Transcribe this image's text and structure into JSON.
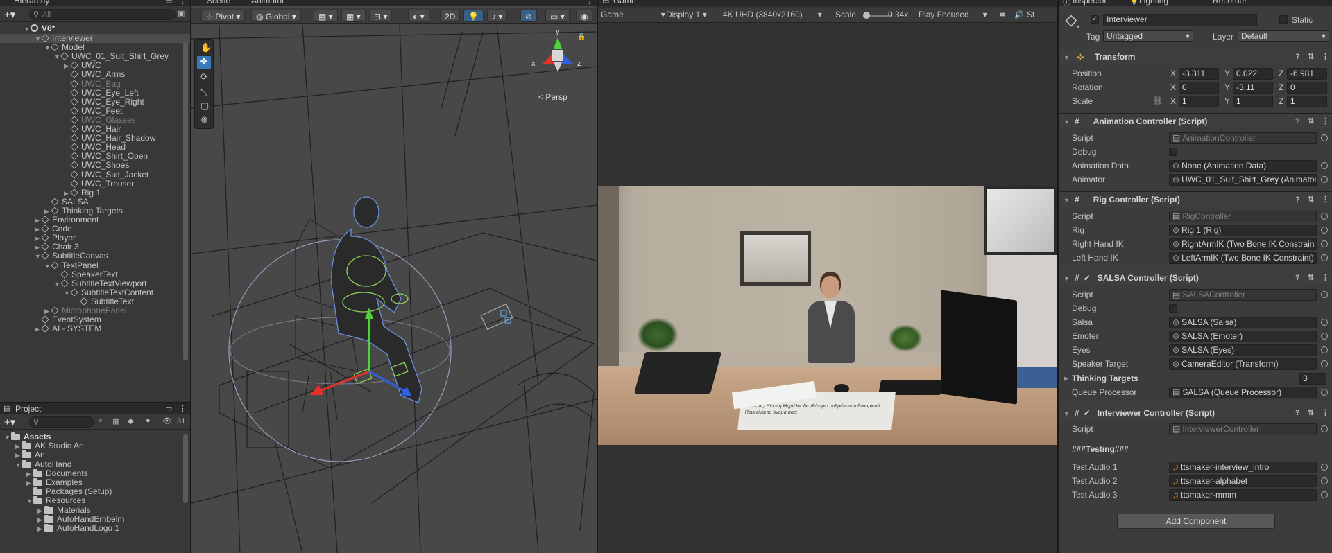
{
  "hierarchy": {
    "tab": "Hierarchy",
    "search_placeholder": "All",
    "scene": "V6*",
    "items": [
      {
        "label": "Interviewer",
        "depth": 1,
        "caret": "▼",
        "dim": false,
        "selected": true
      },
      {
        "label": "Model",
        "depth": 2,
        "caret": "▼",
        "dim": false
      },
      {
        "label": "UWC_01_Suit_Shirt_Grey",
        "depth": 3,
        "caret": "▼",
        "dim": false
      },
      {
        "label": "UWC",
        "depth": 4,
        "caret": "▶",
        "dim": false
      },
      {
        "label": "UWC_Arms",
        "depth": 4,
        "caret": "",
        "dim": false
      },
      {
        "label": "UWC_Bag",
        "depth": 4,
        "caret": "",
        "dim": true
      },
      {
        "label": "UWC_Eye_Left",
        "depth": 4,
        "caret": "",
        "dim": false
      },
      {
        "label": "UWC_Eye_Right",
        "depth": 4,
        "caret": "",
        "dim": false
      },
      {
        "label": "UWC_Feet",
        "depth": 4,
        "caret": "",
        "dim": false
      },
      {
        "label": "UWC_Glasses",
        "depth": 4,
        "caret": "",
        "dim": true
      },
      {
        "label": "UWC_Hair",
        "depth": 4,
        "caret": "",
        "dim": false
      },
      {
        "label": "UWC_Hair_Shadow",
        "depth": 4,
        "caret": "",
        "dim": false
      },
      {
        "label": "UWC_Head",
        "depth": 4,
        "caret": "",
        "dim": false
      },
      {
        "label": "UWC_Shirt_Open",
        "depth": 4,
        "caret": "",
        "dim": false
      },
      {
        "label": "UWC_Shoes",
        "depth": 4,
        "caret": "",
        "dim": false
      },
      {
        "label": "UWC_Suit_Jacket",
        "depth": 4,
        "caret": "",
        "dim": false
      },
      {
        "label": "UWC_Trouser",
        "depth": 4,
        "caret": "",
        "dim": false
      },
      {
        "label": "Rig 1",
        "depth": 4,
        "caret": "▶",
        "dim": false
      },
      {
        "label": "SALSA",
        "depth": 2,
        "caret": "",
        "dim": false
      },
      {
        "label": "Thinking Targets",
        "depth": 2,
        "caret": "▶",
        "dim": false
      },
      {
        "label": "Environment",
        "depth": 1,
        "caret": "▶",
        "dim": false
      },
      {
        "label": "Code",
        "depth": 1,
        "caret": "▶",
        "dim": false
      },
      {
        "label": "Player",
        "depth": 1,
        "caret": "▶",
        "dim": false
      },
      {
        "label": "Chair 3",
        "depth": 1,
        "caret": "▶",
        "dim": false
      },
      {
        "label": "SubtitleCanvas",
        "depth": 1,
        "caret": "▼",
        "dim": false
      },
      {
        "label": "TextPanel",
        "depth": 2,
        "caret": "▼",
        "dim": false
      },
      {
        "label": "SpeakerText",
        "depth": 3,
        "caret": "",
        "dim": false
      },
      {
        "label": "SubtitleTextViewport",
        "depth": 3,
        "caret": "▼",
        "dim": false
      },
      {
        "label": "SubtitleTextContent",
        "depth": 4,
        "caret": "▼",
        "dim": false
      },
      {
        "label": "SubtitleText",
        "depth": 5,
        "caret": "",
        "dim": false
      },
      {
        "label": "MicrophonePanel",
        "depth": 2,
        "caret": "▶",
        "dim": true
      },
      {
        "label": "EventSystem",
        "depth": 1,
        "caret": "",
        "dim": false
      },
      {
        "label": "AI - SYSTEM",
        "depth": 1,
        "caret": "▶",
        "dim": false
      }
    ]
  },
  "project": {
    "tab": "Project",
    "count": "31",
    "items": [
      {
        "label": "Assets",
        "depth": 0,
        "caret": "▼",
        "bold": true
      },
      {
        "label": "AK Studio Art",
        "depth": 1,
        "caret": "▶"
      },
      {
        "label": "Art",
        "depth": 1,
        "caret": "▶"
      },
      {
        "label": "AutoHand",
        "depth": 1,
        "caret": "▼"
      },
      {
        "label": "Documents",
        "depth": 2,
        "caret": "▶"
      },
      {
        "label": "Examples",
        "depth": 2,
        "caret": "▶"
      },
      {
        "label": "Packages (Setup)",
        "depth": 2,
        "caret": ""
      },
      {
        "label": "Resources",
        "depth": 2,
        "caret": "▼"
      },
      {
        "label": "Materials",
        "depth": 3,
        "caret": "▶"
      },
      {
        "label": "AutoHandEmbelm",
        "depth": 3,
        "caret": "▶"
      },
      {
        "label": "AutoHandLogo 1",
        "depth": 3,
        "caret": "▶"
      }
    ]
  },
  "scene": {
    "tabs": [
      "Scene",
      "Animator"
    ],
    "pivot": "Pivot",
    "global": "Global",
    "mode_2d": "2D",
    "persp": "< Persp",
    "gizmo_y": "y",
    "gizmo_x": "x",
    "gizmo_z": "z"
  },
  "game": {
    "tab": "Game",
    "view": "Game",
    "display": "Display 1",
    "resolution": "4K UHD (3840x2160)",
    "scale_label": "Scale",
    "scale_value": "0.34x",
    "play_mode": "Play Focused",
    "stats": "St",
    "note_title": "Μιχαέλα",
    "note_text": "Γεια σας! Είμαι η Μιχαέλα, διευθύντρια ανθρώπινου δυναμικού. Ποιο είναι το όνομά σας;"
  },
  "inspector": {
    "tabs": [
      "Inspector",
      "Lighting",
      "Recorder"
    ],
    "object_name": "Interviewer",
    "static_label": "Static",
    "tag_label": "Tag",
    "tag_value": "Untagged",
    "layer_label": "Layer",
    "layer_value": "Default",
    "transform": {
      "title": "Transform",
      "position_label": "Position",
      "rotation_label": "Rotation",
      "scale_label": "Scale",
      "position": [
        "-3.311",
        "0.022",
        "-6.981"
      ],
      "rotation": [
        "0",
        "-3.11",
        "0"
      ],
      "scale": [
        "1",
        "1",
        "1"
      ]
    },
    "animation_controller": {
      "title": "Animation Controller (Script)",
      "rows": [
        {
          "label": "Script",
          "value": "AnimationController",
          "dim": true
        },
        {
          "label": "Debug",
          "checkbox": true
        },
        {
          "label": "Animation Data",
          "value": "None (Animation Data)"
        },
        {
          "label": "Animator",
          "value": "UWC_01_Suit_Shirt_Grey (Animator)"
        }
      ]
    },
    "rig_controller": {
      "title": "Rig Controller (Script)",
      "rows": [
        {
          "label": "Script",
          "value": "RigController",
          "dim": true
        },
        {
          "label": "Rig",
          "value": "Rig 1 (Rig)"
        },
        {
          "label": "Right Hand IK",
          "value": "RightArmIK (Two Bone IK Constrain"
        },
        {
          "label": "Left Hand IK",
          "value": "LeftArmIK (Two Bone IK Constraint)"
        }
      ]
    },
    "salsa_controller": {
      "title": "SALSA Controller (Script)",
      "rows": [
        {
          "label": "Script",
          "value": "SALSAController",
          "dim": true
        },
        {
          "label": "Debug",
          "checkbox": true
        },
        {
          "label": "Salsa",
          "value": "SALSA (Salsa)"
        },
        {
          "label": "Emoter",
          "value": "SALSA (Emoter)"
        },
        {
          "label": "Eyes",
          "value": "SALSA (Eyes)"
        },
        {
          "label": "Speaker Target",
          "value": "CameraEditor (Transform)"
        }
      ],
      "thinking_label": "Thinking Targets",
      "thinking_count": "3",
      "queue_label": "Queue Processor",
      "queue_value": "SALSA (Queue Processor)"
    },
    "interviewer_controller": {
      "title": "Interviewer Controller (Script)",
      "script_label": "Script",
      "script_value": "InterviewerController",
      "testing_header": "###Testing###",
      "audio": [
        {
          "label": "Test Audio 1",
          "value": "ttsmaker-interview_intro"
        },
        {
          "label": "Test Audio 2",
          "value": "ttsmaker-alphabet"
        },
        {
          "label": "Test Audio 3",
          "value": "ttsmaker-mmm"
        }
      ]
    },
    "add_component": "Add Component"
  },
  "colors": {
    "panel": "#383838",
    "selection": "#4d4d4d",
    "field": "#2a2a2a",
    "accent_blue": "#3a79bb"
  }
}
